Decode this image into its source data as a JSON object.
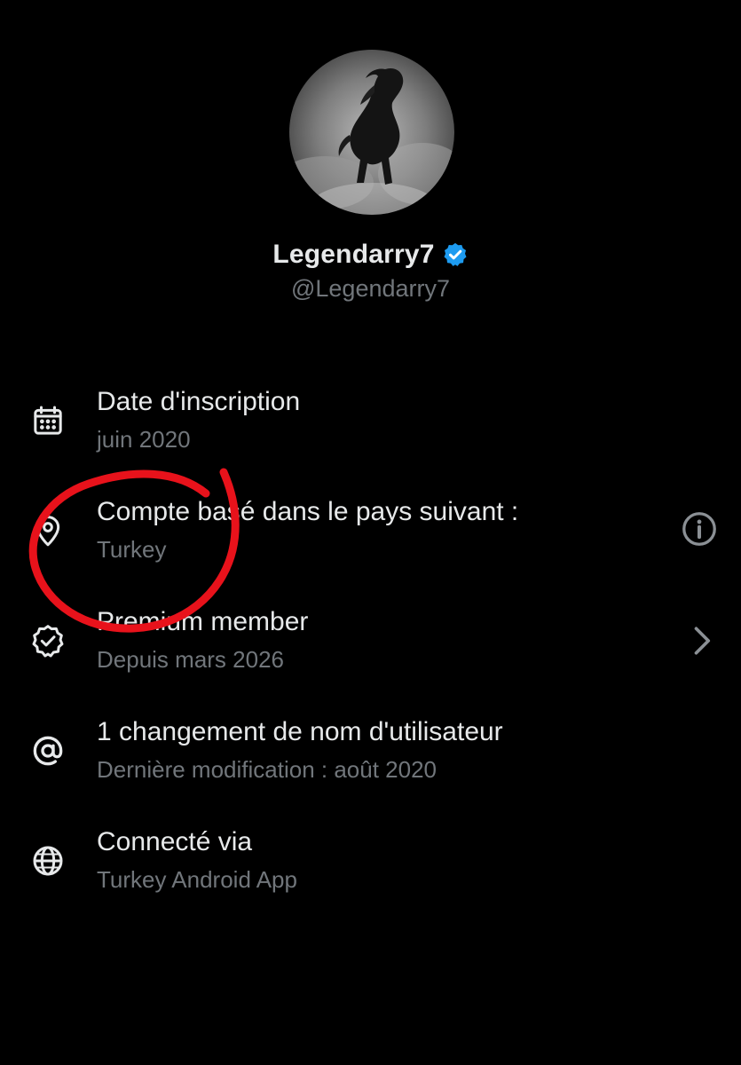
{
  "profile": {
    "display_name": "Legendarry7",
    "handle": "@Legendarry7",
    "verified": true,
    "avatar_subject": "black horse running through smoke"
  },
  "rows": [
    {
      "icon": "calendar-icon",
      "title": "Date d'inscription",
      "subtitle": "juin 2020"
    },
    {
      "icon": "location-pin-icon",
      "title": "Compte basé dans le pays suivant :",
      "subtitle": "Turkey",
      "trailing": "info-icon"
    },
    {
      "icon": "verified-badge-icon",
      "title": "Premium member",
      "subtitle": "Depuis mars 2026",
      "trailing": "chevron-right-icon"
    },
    {
      "icon": "at-icon",
      "title": "1 changement de nom d'utilisateur",
      "subtitle": "Dernière modification : août 2020"
    },
    {
      "icon": "globe-icon",
      "title": "Connecté via",
      "subtitle": "Turkey Android App"
    }
  ],
  "colors": {
    "background": "#000000",
    "primary_text": "#e7e9ea",
    "secondary_text": "#71767b",
    "verified_blue": "#1d9bf0",
    "annotation_red": "#e8121b"
  }
}
